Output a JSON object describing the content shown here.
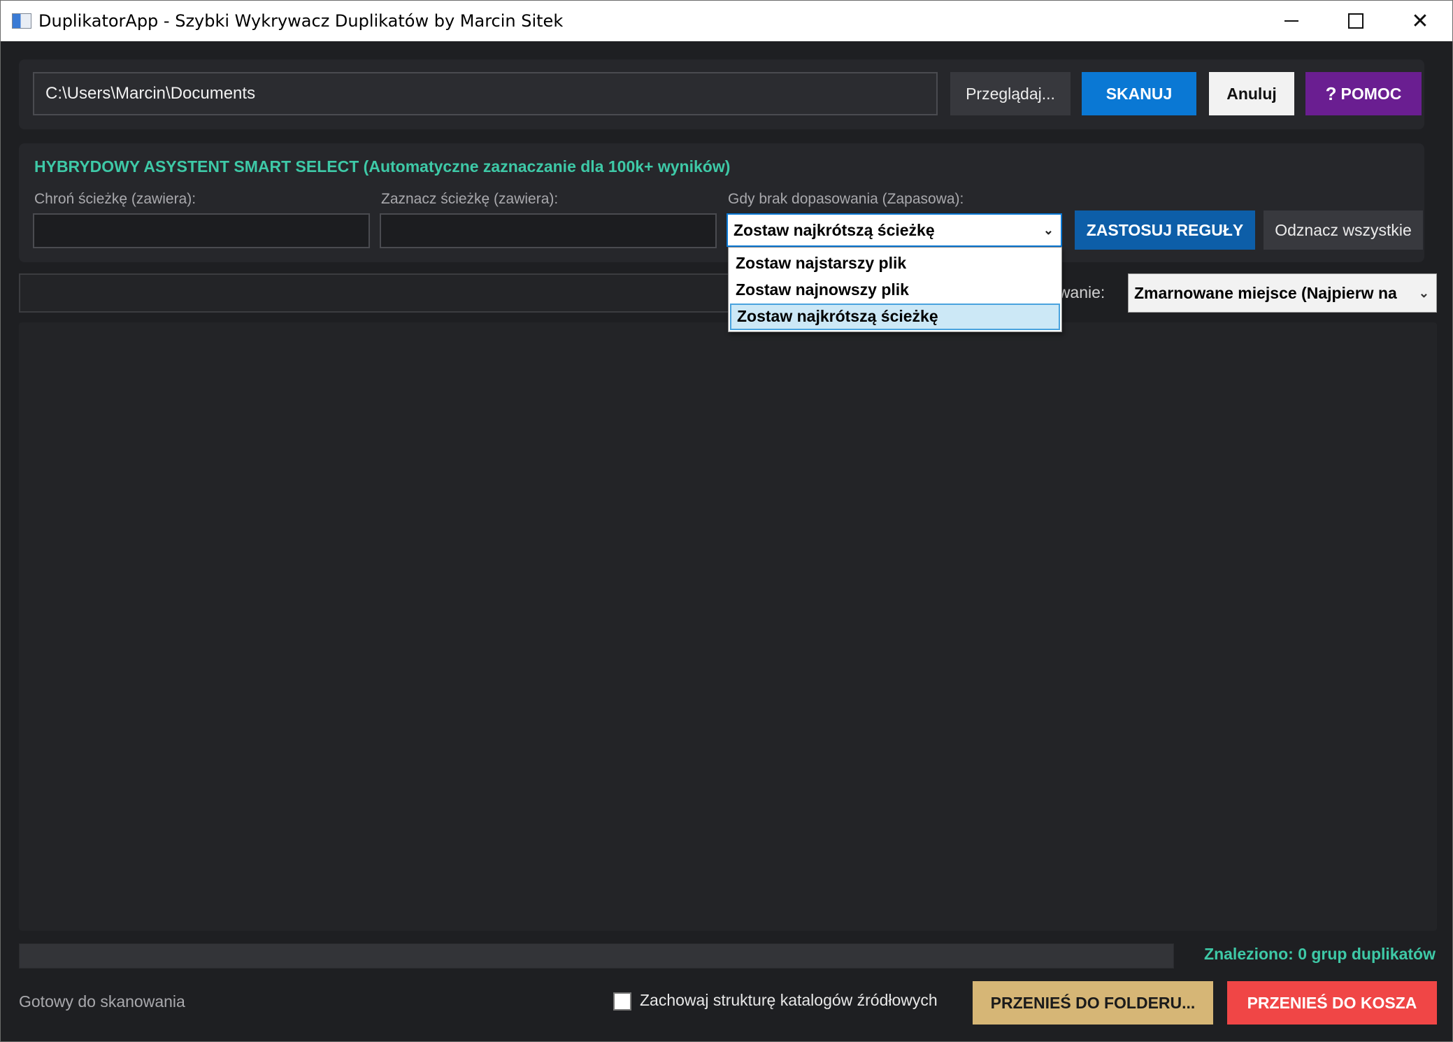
{
  "window": {
    "title": "DuplikatorApp - Szybki Wykrywacz Duplikatów by Marcin Sitek",
    "controls": {
      "minimize": "—",
      "maximize": "☐",
      "close": "✕"
    }
  },
  "top_bar": {
    "path_value": "C:\\Users\\Marcin\\Documents",
    "browse_label": "Przeglądaj...",
    "scan_label": "SKANUJ",
    "cancel_label": "Anuluj",
    "help_label": "POMOC",
    "help_icon": "?"
  },
  "smart_select": {
    "title": "HYBRYDOWY ASYSTENT SMART SELECT (Automatyczne zaznaczanie dla 100k+ wyników)",
    "protect_label": "Chroń ścieżkę (zawiera):",
    "protect_value": "",
    "mark_label": "Zaznacz ścieżkę (zawiera):",
    "mark_value": "",
    "fallback_label": "Gdy brak dopasowania (Zapasowa):",
    "fallback_selected": "Zostaw najkrótszą ścieżkę",
    "fallback_options": [
      "Zostaw najstarszy plik",
      "Zostaw najnowszy plik",
      "Zostaw najkrótszą ścieżkę"
    ],
    "apply_label": "ZASTOSUJ REGUŁY",
    "unmark_label": "Odznacz wszystkie"
  },
  "filter_row": {
    "filter_value": "",
    "sort_label_visible": "owanie:",
    "sort_selected": "Zmarnowane miejsce (Najpierw na"
  },
  "footer": {
    "progress": 0,
    "found_text": "Znaleziono: 0 grup duplikatów",
    "status_text": "Gotowy do skanowania",
    "keep_structure_label": "Zachowaj strukturę katalogów źródłowych",
    "keep_structure_checked": false,
    "move_folder_label": "PRZENIEŚ DO FOLDERU...",
    "move_trash_label": "PRZENIEŚ DO KOSZA"
  },
  "colors": {
    "accent_teal": "#3ec9a7",
    "scan_blue": "#0a78d4",
    "help_purple": "#6a1e91",
    "move_folder_gold": "#d6b676",
    "move_trash_red": "#f04646"
  }
}
